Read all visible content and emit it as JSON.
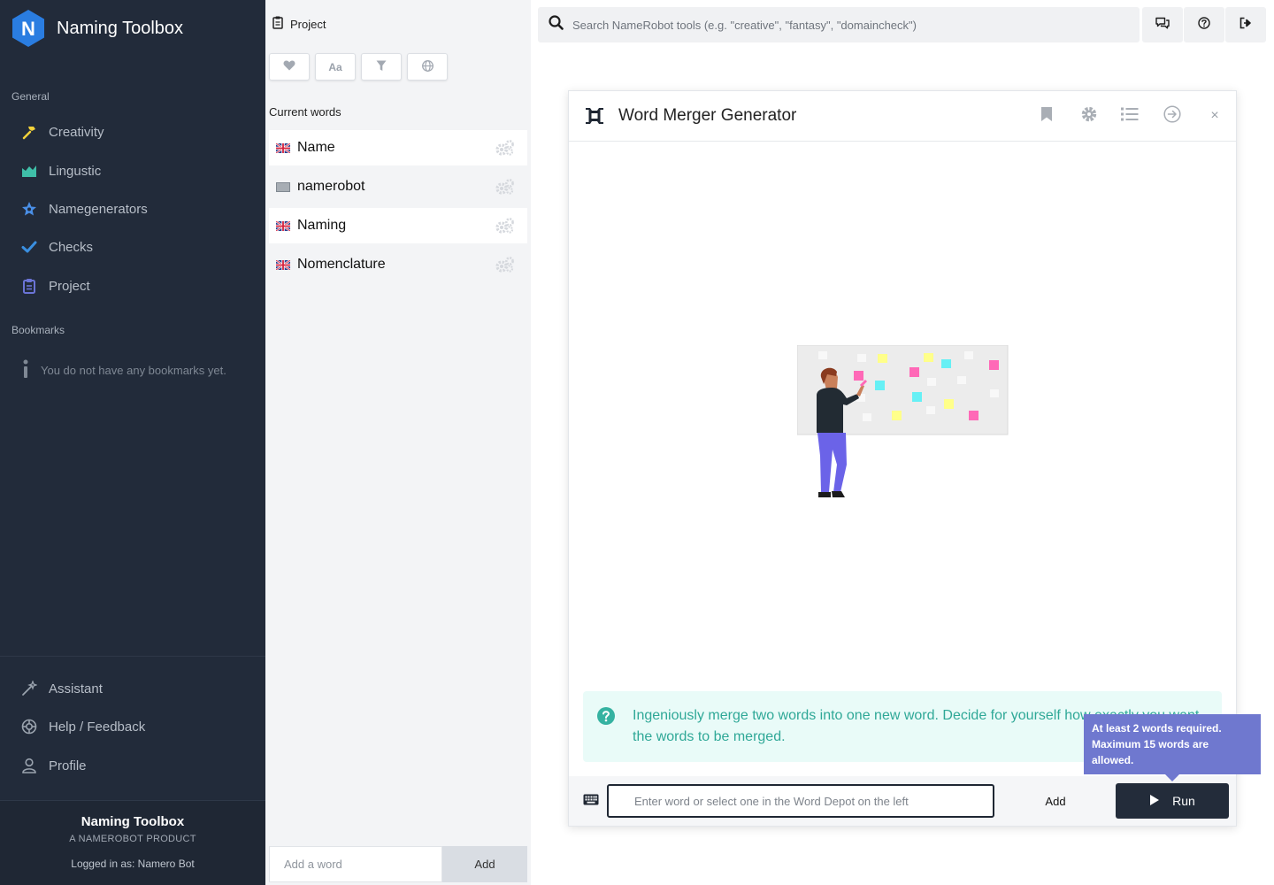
{
  "sidebar": {
    "brand_letter": "N",
    "brand_title": "Naming Toolbox",
    "general_label": "General",
    "nav": [
      {
        "label": "Creativity",
        "icon": "hammer-icon"
      },
      {
        "label": "Lingustic",
        "icon": "chart-icon"
      },
      {
        "label": "Namegenerators",
        "icon": "star-icon"
      },
      {
        "label": "Checks",
        "icon": "check-icon"
      },
      {
        "label": "Project",
        "icon": "clipboard-icon"
      }
    ],
    "bookmarks_label": "Bookmarks",
    "bookmarks_empty": "You do not have any bookmarks yet.",
    "bottom_nav": [
      {
        "label": "Assistant",
        "icon": "wand-icon"
      },
      {
        "label": "Help / Feedback",
        "icon": "lifebuoy-icon"
      },
      {
        "label": "Profile",
        "icon": "user-icon"
      }
    ],
    "footer": {
      "title": "Naming Toolbox",
      "subtitle": "A NAMEROBOT PRODUCT",
      "logged_in": "Logged in as: Namero Bot"
    }
  },
  "project": {
    "title": "Project",
    "toolbar": [
      {
        "icon": "heart-icon"
      },
      {
        "icon": "font-case-icon",
        "text": "Aa"
      },
      {
        "icon": "filter-icon"
      },
      {
        "icon": "globe-icon"
      }
    ],
    "current_words_label": "Current words",
    "words": [
      {
        "text": "Name",
        "flag": "uk-flag-icon"
      },
      {
        "text": "namerobot",
        "flag": "neutral-flag-icon"
      },
      {
        "text": "Naming",
        "flag": "uk-flag-icon"
      },
      {
        "text": "Nomenclature",
        "flag": "uk-flag-icon"
      }
    ],
    "add_word_placeholder": "Add a word",
    "add_label": "Add"
  },
  "topbar": {
    "search_placeholder": "Search NameRobot tools (e.g. \"creative\", \"fantasy\", \"domaincheck\")"
  },
  "modal": {
    "title": "Word Merger Generator",
    "close": "×",
    "info_text": "Ingeniously merge two words into one new word. Decide for yourself how exactly you want the words to be merged.",
    "input_placeholder": "Enter word or select one in the Word Depot on the left",
    "add_label": "Add",
    "run_label": "Run"
  },
  "tooltip": {
    "text": "At least 2 words required. Maximum 15 words are allowed."
  },
  "colors": {
    "sidebar_bg": "#222b3a",
    "brand_blue": "#2a7de1",
    "info_teal": "#2fa897",
    "tooltip_purple": "#6f78cf"
  }
}
